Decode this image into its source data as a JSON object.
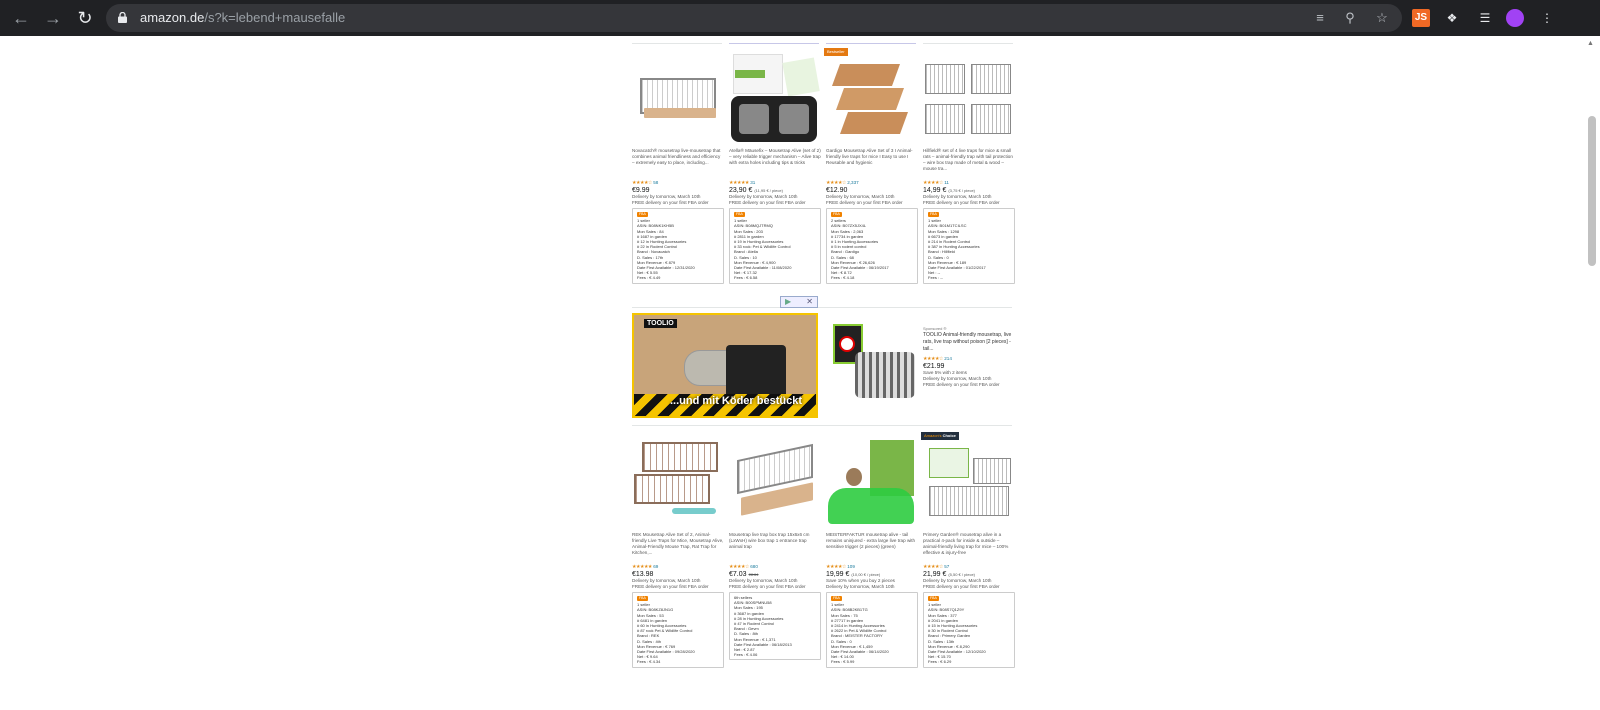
{
  "browser": {
    "url_host": "amazon.de",
    "url_path": "/s?k=lebend+mausefalle",
    "ext_js_label": "JS"
  },
  "rows": [
    [
      {
        "title": "Novacatch® mousetrap live-mousetrap that combines animal friendliness and efficiency – extremely easy to place, including...",
        "stars": "★★★★☆",
        "reviews": "58",
        "price": "€9.99",
        "price_extra": "",
        "delivery": "Delivery by tomorrow, March 10th",
        "delivery2": "FREE delivery on your first FBA order",
        "info": [
          "1 seller",
          "ASIN: B08NK1KH5B",
          "Mon Sales : 84",
          "# 1687 in garden",
          "# 12 in Hunting Accessories",
          "# 22 in Rodent Control",
          "Brand : Novacatch",
          "D. Sales : 17th",
          "Mon Revenue : € 879",
          "Date First Available : 12/31/2020",
          "Net : € 5.55",
          "Fees : € 4.49"
        ]
      },
      {
        "title": "Atella® Mäusefix – Mousetrap Alive (set of 2) – very reliable trigger mechanism – Alive trap with extra holes including tips & tricks",
        "stars": "★★★★★",
        "reviews": "31",
        "price": "23,90 €",
        "price_extra": "(11,95 € / piece)",
        "delivery": "Delivery by tomorrow, March 10th",
        "delivery2": "FREE delivery on your first FBA order",
        "info": [
          "1 seller",
          "ASIN: B08MQJTRMQ",
          "Mon Sales : 203",
          "# 2811 in garden",
          "# 19 in Hunting Accessories",
          "# 33 rock: Pet & Wildlife Control",
          "Brand : Atella",
          "D. Sales : 10",
          "Mon Revenue : € 4,900",
          "Date First Available : 11/08/2020",
          "Net : € 17.32",
          "Fees : € 6.58"
        ]
      },
      {
        "title": "Gardigo Mousetrap Alive Set of 3 I Animal-friendly live traps for mice I Easy to use I Reusable and hygienic",
        "stars": "★★★★☆",
        "reviews": "2,337",
        "price": "€12.90",
        "price_extra": "",
        "delivery": "Delivery by tomorrow, March 10th",
        "delivery2": "FREE delivery on your first FBA order",
        "info": [
          "2 sellers",
          "ASIN: B07ZX5JX4L",
          "Mon Sales : 2,063",
          "# 17734 in garden",
          "# 1 in Hunting Accessories",
          "# 5 in rodent control",
          "Brand : Gardigo",
          "D. Sales : 68",
          "Mon Revenue : € 26,626",
          "Date First Available : 06/19/2017",
          "Net : € 8.72",
          "Fees : € 4.18"
        ]
      },
      {
        "title": "Hillfield® set of 4 live traps for mice & small rats – animal-friendly trap with tail protection – wire box trap made of metal & wood – mouse tra...",
        "stars": "★★★★☆",
        "reviews": "11",
        "price": "14,99 €",
        "price_extra": "(3,75 € / piece)",
        "delivery": "Delivery by tomorrow, March 10th",
        "delivery2": "FREE delivery on your first FBA order",
        "info": [
          "1 seller",
          "ASIN: B01M1TCILSC",
          "Mon Sales : 1298",
          "# 6673 in garden",
          "# 214 in Rodent Control",
          "# 387 in Hunting Accessories",
          "Brand : Hillfield",
          "D. Sales : 0",
          "Mon Revenue : € 189",
          "Date First Available : 01/22/2017",
          "Net : --",
          "Fees : --"
        ]
      }
    ],
    [
      {
        "title": "REK Mousetrap Alive Set of 2, Animal-friendly Live Traps for Mice, Mousetrap Alive, Animal-Friendly Mouse Trap, Rat Trap for Kitchen,...",
        "stars": "★★★★★",
        "reviews": "69",
        "price": "€13.98",
        "price_extra": "",
        "delivery": "Delivery by tomorrow, March 10th",
        "delivery2": "FREE delivery on your first FBA order",
        "info": [
          "1 seller",
          "ASIN: B08KZ8JN1G",
          "Mon Sales : 53",
          "# 6481 in garden",
          "# 60 in Hunting Accessories",
          "# 87 rock Pet & Wildlife Control",
          "Brand : REK",
          "D. Sales : 4th",
          "Mon Revenue : € 769",
          "Date First Available : 09/28/2020",
          "Net : € 9.64",
          "Fees : € 4.34"
        ]
      },
      {
        "title": "Mousetrap live trap box trap 15x6x6 cm (LxWxH) wire box trap 1 entrance trap animal trap",
        "stars": "★★★★☆",
        "reviews": "680",
        "price": "€7.03",
        "price_extra": "€8.64",
        "delivery": "Delivery by tomorrow, March 10th",
        "delivery2": "FREE delivery on your first FBA order",
        "info": [
          "6th sellers",
          "ASIN: B00SPMNU58",
          "Mon Sales : 195",
          "# 3687 in garden",
          "# 28 in Hunting Accessories",
          "# 47 in Rodent Control",
          "Brand : Gevm",
          "D. Sales : 8th",
          "Mon Revenue : € 1,371",
          "Date First Available : 06/18/2013",
          "Net : € 2.87",
          "Fees : € 4.06"
        ]
      },
      {
        "title": "MEISTERFAKTUR mousetrap alive - tail remains uninjured - extra large live trap with sensitive trigger (2 pieces) (green)",
        "stars": "★★★★☆",
        "reviews": "109",
        "price": "19,99 €",
        "price_extra": "(10,00 € / piece)",
        "delivery": "Save 10% when you buy 2 pieces",
        "delivery2": "Delivery by tomorrow, March 10th",
        "info": [
          "1 seller",
          "ASIN: B08B2KB1TG",
          "Mon Sales : 75",
          "# 27717 in garden",
          "# 2414 in Hunting Accessories",
          "# 2622 in Pet & Wildlife Control",
          "Brand : MEISTER FACTORY",
          "D. Sales : 0",
          "Mon Revenue : € 1,459",
          "Date First Available : 06/14/2020",
          "Net : € 14.00",
          "Fees : € 5.99"
        ]
      },
      {
        "title": "Primery Garden® mousetrap alive in a practical 4-pack for inside & outside – animal-friendly living trap for mice – 100% effective & injury-free",
        "stars": "★★★★☆",
        "reviews": "57",
        "price": "21,99 €",
        "price_extra": "(5,50 € / piece)",
        "delivery": "Delivery by tomorrow, March 10th",
        "delivery2": "FREE delivery on your first FBA order",
        "info": [
          "1 seller",
          "ASIN: B08S7Q1Z9Y",
          "Mon Sales : 377",
          "# 2041 in garden",
          "# 15 in Hunting Accessories",
          "# 30 in Rodent Control",
          "Brand : Primery Garden",
          "D. Sales : 13th",
          "Mon Revenue : € 8,290",
          "Date First Available : 12/10/2020",
          "Net : € 15.70",
          "Fees : € 6.29"
        ]
      }
    ]
  ],
  "sponsored": {
    "video_logo": "TOOLIO",
    "video_caption": "...und mit Köder bestückt",
    "label": "Sponsored ®",
    "title": "TOOLIO Animal-friendly mousetrap, live rats, live trap without poison [2 pieces] - tail...",
    "stars": "★★★★☆",
    "reviews": "214",
    "price": "€21.99",
    "save": "Save 5% with 2 items",
    "delivery": "Delivery by tomorrow, March 10th",
    "delivery2": "FREE delivery on your first FBA order"
  },
  "badges": {
    "bestseller": "Bestseller",
    "choice_a": "Amazon's",
    "choice_b": "Choice",
    "info_badge": "FBA"
  }
}
